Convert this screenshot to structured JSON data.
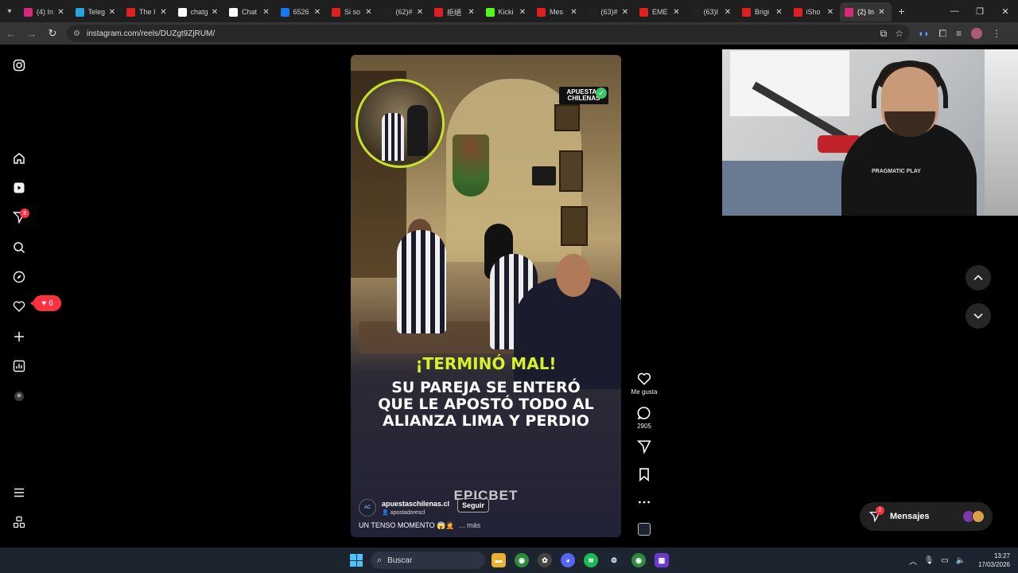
{
  "browser": {
    "tabs": [
      {
        "label": "(4) In",
        "icon": "instagram-icon",
        "color": "#d6297a"
      },
      {
        "label": "Teleg",
        "icon": "telegram-icon",
        "color": "#2aa3de"
      },
      {
        "label": "The I",
        "icon": "youtube-icon",
        "color": "#e02020"
      },
      {
        "label": "chatg",
        "icon": "google-icon",
        "color": "#ffffff"
      },
      {
        "label": "Chat",
        "icon": "chatgpt-icon",
        "color": "#ffffff"
      },
      {
        "label": "6526",
        "icon": "facebook-icon",
        "color": "#1877f2"
      },
      {
        "label": "Si so",
        "icon": "youtube-icon",
        "color": "#e02020"
      },
      {
        "label": "(62)#",
        "icon": "tiktok-icon",
        "color": "#222222"
      },
      {
        "label": "拒絕",
        "icon": "youtube-icon",
        "color": "#e02020"
      },
      {
        "label": "Kicki",
        "icon": "kick-icon",
        "color": "#53fc18"
      },
      {
        "label": "Mes",
        "icon": "youtube-icon",
        "color": "#e02020"
      },
      {
        "label": "(63)#",
        "icon": "tiktok-icon",
        "color": "#222222"
      },
      {
        "label": "EME",
        "icon": "youtube-icon",
        "color": "#e02020"
      },
      {
        "label": "(63)I",
        "icon": "tiktok-icon",
        "color": "#222222"
      },
      {
        "label": "Brigi",
        "icon": "youtube-icon",
        "color": "#e02020"
      },
      {
        "label": "iSho",
        "icon": "youtube-icon",
        "color": "#e02020"
      },
      {
        "label": "(2) In",
        "icon": "instagram-icon",
        "color": "#d6297a"
      }
    ],
    "active_tab_index": 16,
    "url": "instagram.com/reels/DUZgt9ZjRUM/"
  },
  "sidebar": {
    "notification_badge": "3",
    "likes_count": "6"
  },
  "reel": {
    "brand_badge": "APUESTAS CHILENAS",
    "headline_1": "¡TERMINÓ MAL!",
    "headline_2": "SU PAREJA SE ENTERÓ QUE LE APOSTÓ TODO AL ALIANZA LIMA Y PERDIO",
    "watermark": "EPICBET",
    "author": "apuestaschilenas.cl",
    "audio": "apostadorescl",
    "follow_label": "Seguir",
    "caption": "UN TENSO MOMENTO 😱🤦",
    "more_label": "... más",
    "like_label": "Me gusta",
    "comment_count": "2905"
  },
  "messages": {
    "label": "Mensajes",
    "badge": "2"
  },
  "taskbar": {
    "search_placeholder": "Buscar",
    "time": "13:27",
    "date": "17/03/2026"
  },
  "colors": {
    "accent_red": "#ff3040",
    "headline_yellow": "#d6f02a",
    "circle_border": "#c8e22a"
  }
}
